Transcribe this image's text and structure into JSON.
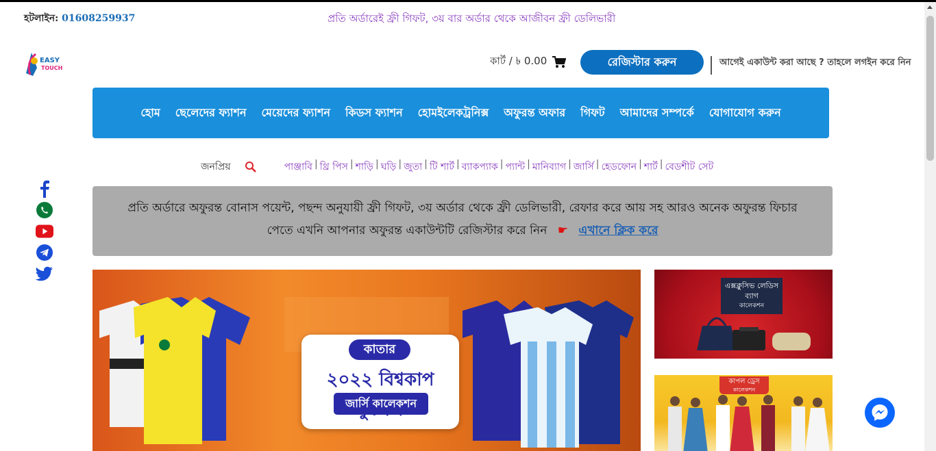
{
  "topbar": {
    "hotline_label": "হটলাইন:",
    "hotline_number": "01608259937"
  },
  "tagline": "প্রতি অর্ডারেই ফ্রী গিফট, ৩য় বার অর্ডার থেকে আজীবন ফ্রী ডেলিভারী",
  "logo": {
    "text": "EASY TOUCH"
  },
  "cart": {
    "label": "কার্ট / ৳ 0.00"
  },
  "register_button": "রেজিস্টার করুন",
  "login_link": "আগেই একাউন্ট করা আছে ? তাহলে লগইন করে নিন",
  "nav": [
    "হোম",
    "ছেলেদের ফ্যাশন",
    "মেয়েদের ফ্যাশন",
    "কিডস ফ্যাশন",
    "হোমইলেকট্রনিক্স",
    "অফুরন্ত অফার",
    "গিফট",
    "আমাদের সম্পর্কে",
    "যোগাযোগ করুন"
  ],
  "popular": {
    "label": "জনপ্রিয়",
    "tags": [
      "পাঞ্জাবি",
      "থ্রি পিস",
      "শাড়ি",
      "ঘড়ি",
      "জুতা",
      "টি শার্ট",
      "ব্যাকপ্যাক",
      "প্যান্ট",
      "মানিব্যাগ",
      "জার্সি",
      "হেডফোন",
      "শার্ট",
      "বেডশীট সেট"
    ]
  },
  "notice": {
    "text": "প্রতি অর্ডারে অফুরন্ত বোনাস পয়েন্ট, পছন্দ অনুযায়ী ফ্রী গিফট, ৩য় অর্ডার থেকে ফ্রী ডেলিভারী, রেফার করে আয় সহ আরও অনেক অফুরন্ত ফিচার পেতে এখনি আপনার অফুরন্ত একাউন্টটি রেজিস্টার করে নিন",
    "link": "এখানে ক্লিক করে"
  },
  "banner": {
    "line1": "কাতার",
    "line2": "২০২২ বিশ্বকাপ ফুটবল",
    "line3": "জার্সি কালেকশন"
  },
  "side_banner_1": {
    "title": "এক্সক্লুসিভ লেডিস ব্যাগ",
    "subtitle": "কালেকশন"
  },
  "side_banner_2": {
    "title": "কাপল ড্রেস",
    "subtitle": "কালেকশন"
  },
  "social_icons": [
    "facebook-icon",
    "whatsapp-icon",
    "youtube-icon",
    "telegram-icon",
    "twitter-icon"
  ],
  "colors": {
    "nav_bg": "#1a8fdb",
    "register_bg": "#0d6fbf",
    "accent_purple": "#8a3fbf",
    "notice_bg": "#ababab"
  }
}
